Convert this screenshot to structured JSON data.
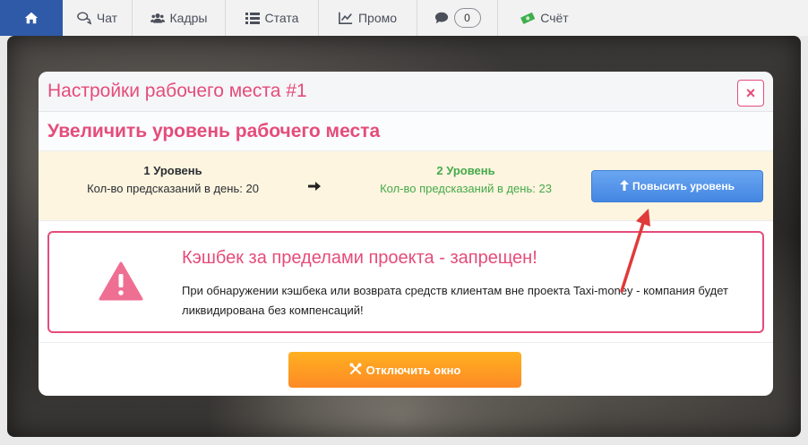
{
  "tabs": [
    {
      "label": "",
      "icon": "home-icon"
    },
    {
      "label": "Чат",
      "icon": "chat-icon"
    },
    {
      "label": "Кадры",
      "icon": "users-icon"
    },
    {
      "label": "Стата",
      "icon": "list-icon"
    },
    {
      "label": "Промо",
      "icon": "chart-line-icon"
    },
    {
      "label": "",
      "icon": "comment-icon",
      "count": "0"
    },
    {
      "label": "Счёт",
      "icon": "money-icon"
    }
  ],
  "modal": {
    "title": "Настройки рабочего места #1",
    "close_label": "×",
    "subtitle": "Увеличить уровень рабочего места",
    "current_level": {
      "name": "1 Уровень",
      "desc": "Кол-во предсказаний в день: 20"
    },
    "next_level": {
      "name": "2 Уровень",
      "desc": "Кол-во предсказаний в день: 23"
    },
    "upgrade_label": "Повысить уровень",
    "warning": {
      "title": "Кэшбек за пределами проекта - запрещен!",
      "text": "При обнаружении кэшбека или возврата средств клиентам вне проекта Taxi-money - компания будет ликвидирована без компенсаций!"
    },
    "disable_label": "Отключить окно"
  },
  "colors": {
    "accent_pink": "#e54c7a",
    "success_green": "#46a94b",
    "primary_blue": "#4486e2",
    "orange": "#fd8a26",
    "home_tab": "#2e5aa8",
    "annotation_red": "#e03a3a"
  }
}
